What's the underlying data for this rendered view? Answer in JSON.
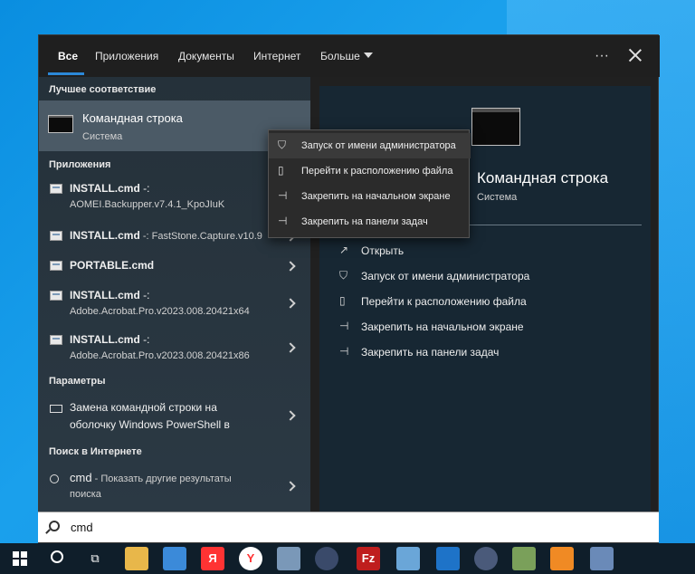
{
  "tabs": [
    {
      "label": "Все"
    },
    {
      "label": "Приложения"
    },
    {
      "label": "Документы"
    },
    {
      "label": "Интернет"
    },
    {
      "label": "Больше"
    }
  ],
  "more_icon": "ellipsis-icon",
  "sections": {
    "best_match": "Лучшее соответствие",
    "apps": "Приложения",
    "settings": "Параметры",
    "web": "Поиск в Интернете"
  },
  "best_match": {
    "title": "Командная строка",
    "subtitle": "Система"
  },
  "apps": [
    {
      "name": "INSTALL.cmd",
      "suffix": " -:",
      "line2": "AOMEI.Backupper.v7.4.1_KpoJIuK"
    },
    {
      "name": "INSTALL.cmd",
      "suffix": " -: FastStone.Capture.v10.9",
      "line2": ""
    },
    {
      "name": "PORTABLE.cmd",
      "suffix": "",
      "line2": ""
    },
    {
      "name": "INSTALL.cmd",
      "suffix": " -:",
      "line2": "Adobe.Acrobat.Pro.v2023.008.20421x64"
    },
    {
      "name": "INSTALL.cmd",
      "suffix": " -:",
      "line2": "Adobe.Acrobat.Pro.v2023.008.20421x86"
    }
  ],
  "settings_item": {
    "line1": "Замена командной строки на",
    "line2": "оболочку Windows PowerShell в"
  },
  "web_item": {
    "name": "cmd",
    "line1_rest": " - Показать другие результаты",
    "line2": "поиска"
  },
  "detail": {
    "title": "Командная строка",
    "subtitle": "Система",
    "actions": [
      {
        "label": "Открыть",
        "icon": "open-icon"
      },
      {
        "label": "Запуск от имени администратора",
        "icon": "shield-icon"
      },
      {
        "label": "Перейти к расположению файла",
        "icon": "file-icon"
      },
      {
        "label": "Закрепить на начальном экране",
        "icon": "pin-icon"
      },
      {
        "label": "Закрепить на панели задач",
        "icon": "pin-icon"
      }
    ]
  },
  "context_menu": [
    {
      "label": "Запуск от имени администратора",
      "icon": "shield-icon"
    },
    {
      "label": "Перейти к расположению файла",
      "icon": "file-icon"
    },
    {
      "label": "Закрепить на начальном экране",
      "icon": "pin-icon"
    },
    {
      "label": "Закрепить на панели задач",
      "icon": "pin-icon"
    }
  ],
  "search": {
    "value": "cmd"
  },
  "taskbar": {
    "yandex_label": "Я",
    "filezilla_label": "Fz",
    "items": [
      "start-icon",
      "search-icon",
      "task-view-icon",
      "file-explorer-icon",
      "remote-desktop-icon",
      "yandex-icon",
      "yandex-browser-icon",
      "app-icon",
      "camera-icon",
      "filezilla-icon",
      "app-icon",
      "vs-code-icon",
      "lock-icon",
      "app-icon",
      "sublime-icon",
      "app-icon"
    ]
  }
}
